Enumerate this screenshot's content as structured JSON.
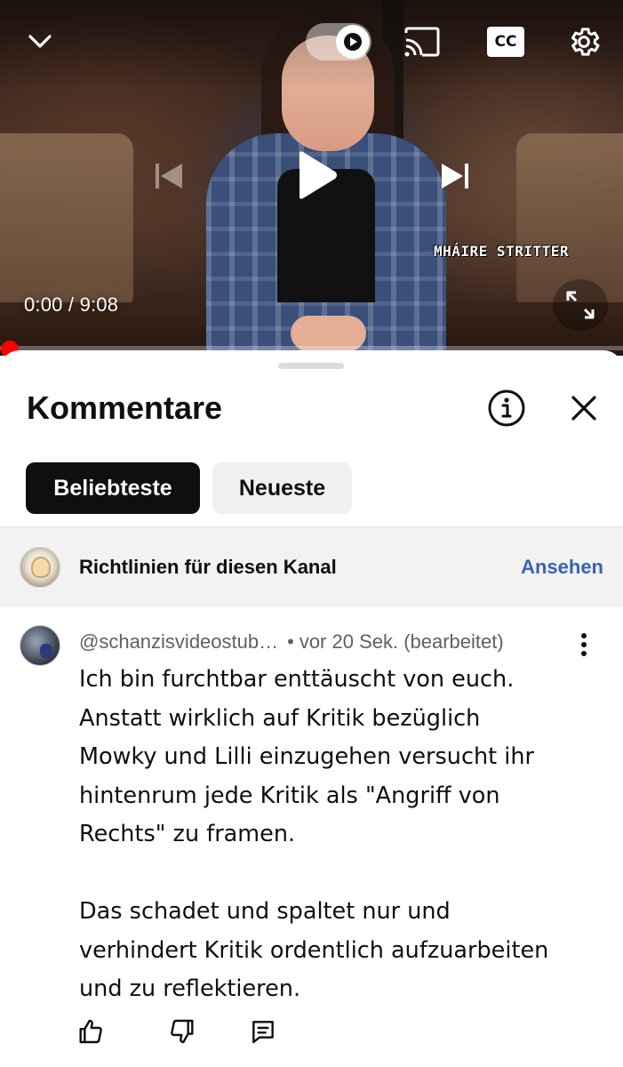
{
  "player": {
    "time_current": "0:00",
    "time_separator": " / ",
    "time_total": "9:08",
    "progress": 0.0,
    "watermark": "MHÁIRE STRITTER",
    "cc_label": "CC",
    "autoplay": true
  },
  "sheet": {
    "title": "Kommentare",
    "chips": [
      {
        "label": "Beliebteste",
        "active": true
      },
      {
        "label": "Neueste",
        "active": false
      }
    ]
  },
  "guidelines": {
    "text": "Richtlinien für diesen Kanal",
    "link": "Ansehen"
  },
  "comment": {
    "author": "@schanzisvideostub…",
    "dot": "•",
    "time": "vor 20 Sek. (bearbeitet)",
    "lines_p1": [
      "Ich bin furchtbar enttäuscht von euch.",
      "Anstatt wirklich auf Kritik bezüglich",
      "Mowky und Lilli einzugehen versucht ihr",
      "hintenrum jede Kritik als \"Angriff von",
      "Rechts\" zu framen."
    ],
    "lines_p2": [
      "Das schadet und spaltet nur und",
      "verhindert Kritik ordentlich aufzuarbeiten",
      "und zu reflektieren."
    ]
  },
  "colors": {
    "accent_red": "#ff0000",
    "link_blue": "#3764b4",
    "chip_active_bg": "#0f0f0f",
    "chip_inactive_bg": "#f0f0f0",
    "guidelines_bg": "#f2f2f2",
    "meta_gray": "#606060"
  },
  "icons": {
    "collapse": "chevron-down-icon",
    "autoplay": "autoplay-toggle-icon",
    "cast": "cast-icon",
    "captions": "cc-icon",
    "settings": "gear-icon",
    "previous": "skip-previous-icon",
    "play": "play-icon",
    "next": "skip-next-icon",
    "fullscreen": "fullscreen-icon",
    "info": "info-icon",
    "close": "close-icon",
    "menu": "more-vertical-icon",
    "like": "thumb-up-icon",
    "dislike": "thumb-down-icon",
    "reply": "comment-reply-icon"
  }
}
